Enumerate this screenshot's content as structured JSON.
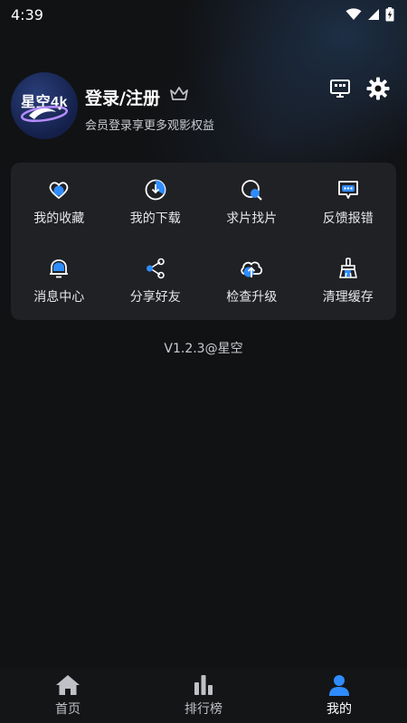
{
  "status_bar": {
    "time": "4:39"
  },
  "profile": {
    "avatar_text": "星空4k",
    "login_label": "登录/注册",
    "subtitle": "会员登录享更多观影权益"
  },
  "menu": {
    "items": [
      {
        "label": "我的收藏",
        "icon": "heart-icon"
      },
      {
        "label": "我的下载",
        "icon": "download-icon"
      },
      {
        "label": "求片找片",
        "icon": "search-film-icon"
      },
      {
        "label": "反馈报错",
        "icon": "feedback-icon"
      },
      {
        "label": "消息中心",
        "icon": "bell-icon"
      },
      {
        "label": "分享好友",
        "icon": "share-icon"
      },
      {
        "label": "检查升级",
        "icon": "cloud-upload-icon"
      },
      {
        "label": "清理缓存",
        "icon": "broom-icon"
      }
    ]
  },
  "version": "V1.2.3@星空",
  "bottom_nav": {
    "items": [
      {
        "label": "首页",
        "icon": "home-icon"
      },
      {
        "label": "排行榜",
        "icon": "ranking-icon"
      },
      {
        "label": "我的",
        "icon": "user-icon"
      }
    ],
    "active_index": 2
  },
  "colors": {
    "accent": "#2f8cff",
    "background": "#111214",
    "card": "#202124"
  }
}
